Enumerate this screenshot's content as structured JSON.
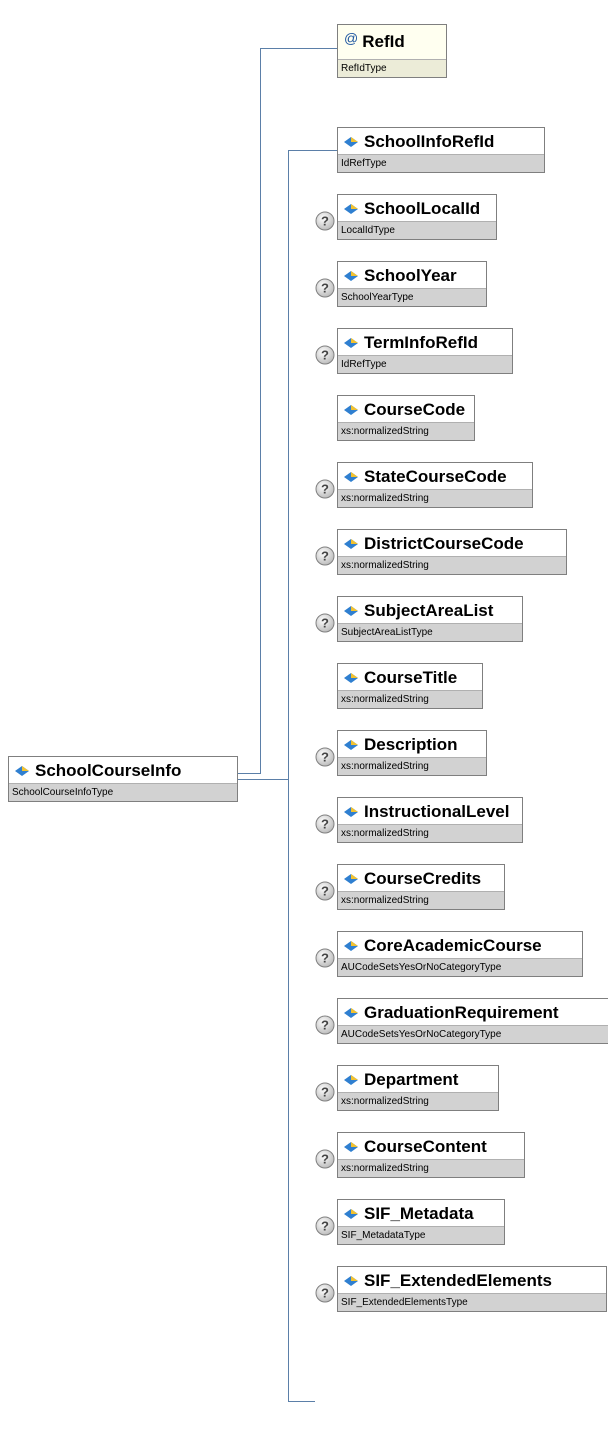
{
  "root": {
    "name": "SchoolCourseInfo",
    "type": "SchoolCourseInfoType"
  },
  "attribute": {
    "symbol": "@",
    "name": "RefId",
    "type": "RefIdType"
  },
  "elements": [
    {
      "name": "SchoolInfoRefId",
      "type": "IdRefType",
      "optional": false
    },
    {
      "name": "SchoolLocalId",
      "type": "LocalIdType",
      "optional": true
    },
    {
      "name": "SchoolYear",
      "type": "SchoolYearType",
      "optional": true
    },
    {
      "name": "TermInfoRefId",
      "type": "IdRefType",
      "optional": true
    },
    {
      "name": "CourseCode",
      "type": "xs:normalizedString",
      "optional": false
    },
    {
      "name": "StateCourseCode",
      "type": "xs:normalizedString",
      "optional": true
    },
    {
      "name": "DistrictCourseCode",
      "type": "xs:normalizedString",
      "optional": true
    },
    {
      "name": "SubjectAreaList",
      "type": "SubjectAreaListType",
      "optional": true
    },
    {
      "name": "CourseTitle",
      "type": "xs:normalizedString",
      "optional": false
    },
    {
      "name": "Description",
      "type": "xs:normalizedString",
      "optional": true
    },
    {
      "name": "InstructionalLevel",
      "type": "xs:normalizedString",
      "optional": true
    },
    {
      "name": "CourseCredits",
      "type": "xs:normalizedString",
      "optional": true
    },
    {
      "name": "CoreAcademicCourse",
      "type": "AUCodeSetsYesOrNoCategoryType",
      "optional": true
    },
    {
      "name": "GraduationRequirement",
      "type": "AUCodeSetsYesOrNoCategoryType",
      "optional": true
    },
    {
      "name": "Department",
      "type": "xs:normalizedString",
      "optional": true
    },
    {
      "name": "CourseContent",
      "type": "xs:normalizedString",
      "optional": true
    },
    {
      "name": "SIF_Metadata",
      "type": "SIF_MetadataType",
      "optional": true
    },
    {
      "name": "SIF_ExtendedElements",
      "type": "SIF_ExtendedElementsType",
      "optional": true
    }
  ],
  "colors": {
    "connector": "#5b7fa8",
    "type_band": "#d2d2d2",
    "attr_bg": "#fffff0",
    "border": "#7f7f7f"
  },
  "icons": {
    "element": "element-diamond-icon",
    "optional": "optional-question-icon",
    "attribute": "attribute-at-icon"
  }
}
